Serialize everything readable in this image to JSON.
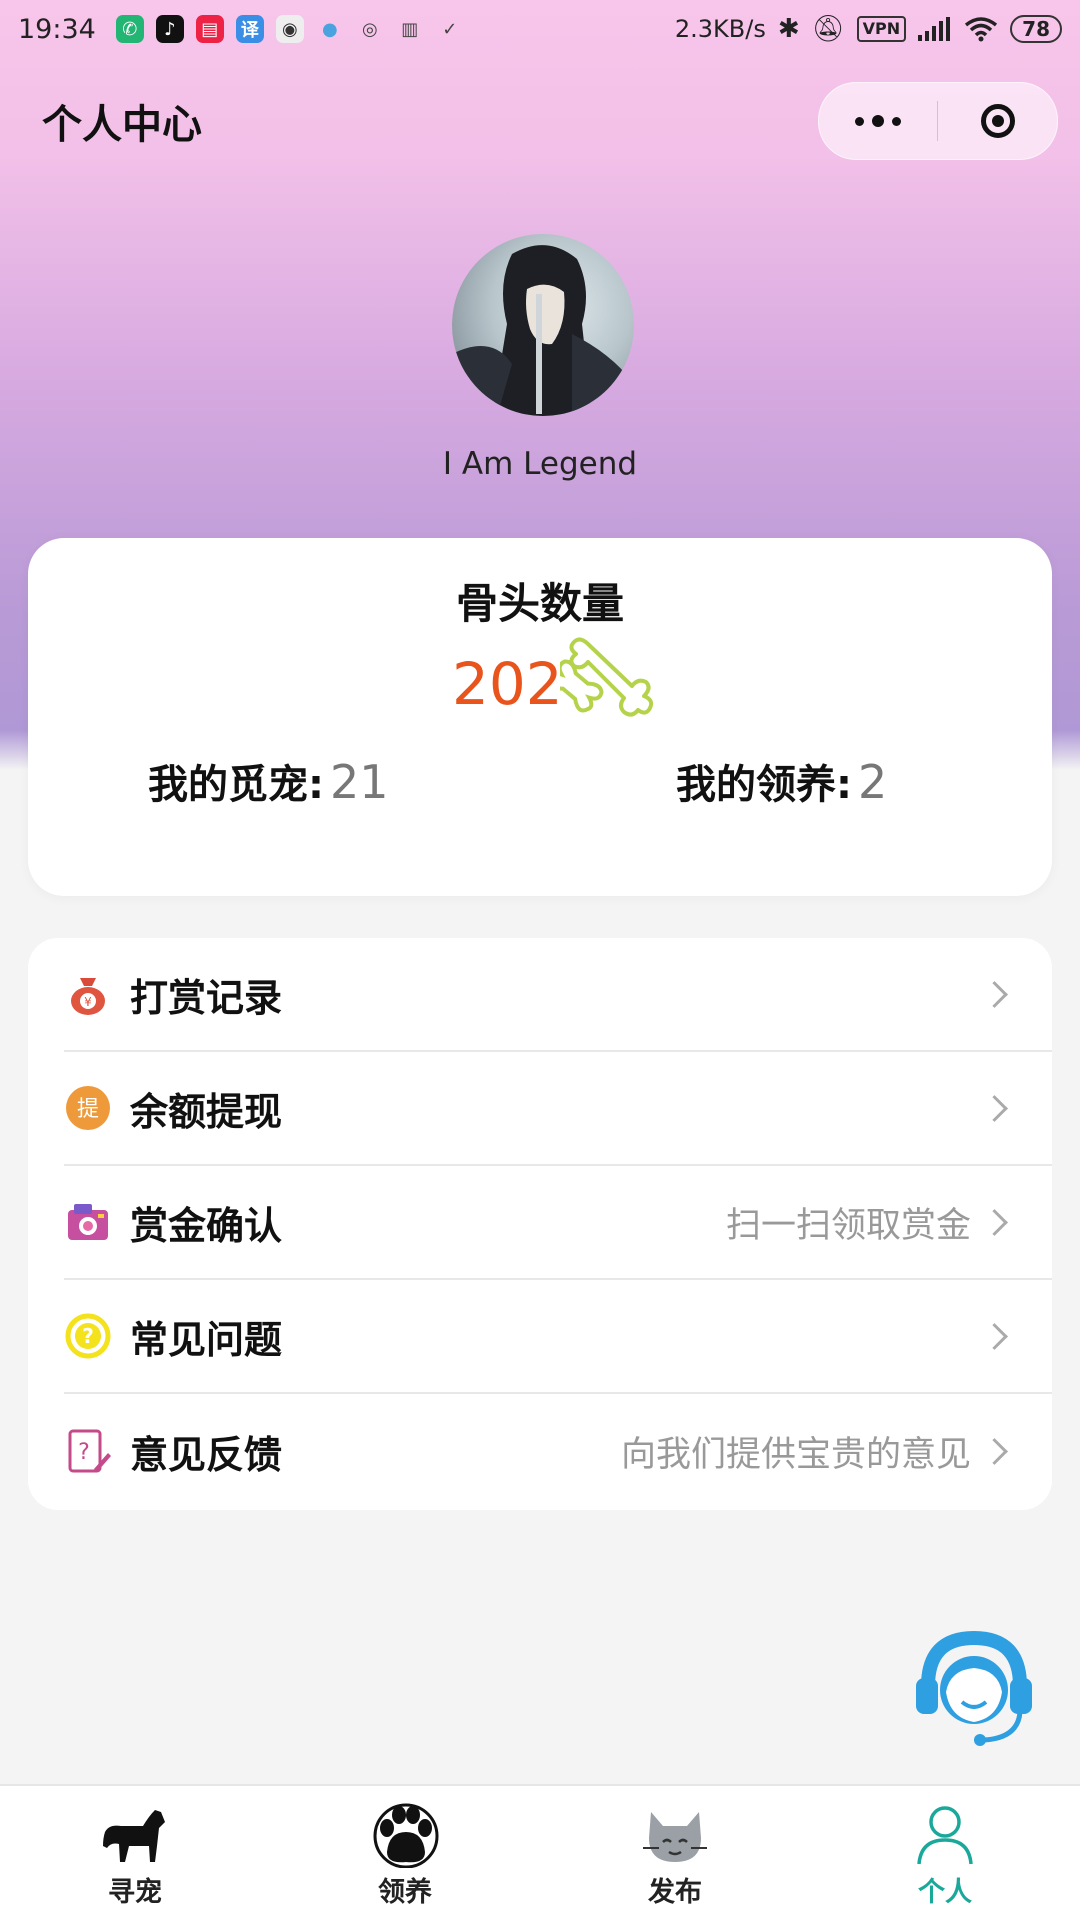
{
  "status_bar": {
    "time": "19:34",
    "net_speed": "2.3KB/s",
    "vpn": "VPN",
    "battery": "78",
    "app_icons": [
      "green-chat-icon",
      "tiktok-icon",
      "docs-icon",
      "translate-icon",
      "eye-icon",
      "balloon-icon",
      "music-icon",
      "trash-icon",
      "check-icon"
    ]
  },
  "nav": {
    "title": "个人中心"
  },
  "profile": {
    "username": "I Am Legend"
  },
  "stats": {
    "bones_title": "骨头数量",
    "bones_count": "202",
    "my_lost_label": "我的觅宠:",
    "my_lost_value": "21",
    "my_adopt_label": "我的领养:",
    "my_adopt_value": "2"
  },
  "menu": [
    {
      "label": "打赏记录",
      "hint": "",
      "icon": "money-bag-icon"
    },
    {
      "label": "余额提现",
      "hint": "",
      "icon": "withdraw-icon",
      "icon_text": "提"
    },
    {
      "label": "赏金确认",
      "hint": "扫一扫领取赏金",
      "icon": "camera-icon"
    },
    {
      "label": "常见问题",
      "hint": "",
      "icon": "question-icon"
    },
    {
      "label": "意见反馈",
      "hint": "向我们提供宝贵的意见",
      "icon": "feedback-icon"
    }
  ],
  "tabs": [
    {
      "label": "寻宠",
      "icon": "dog-icon"
    },
    {
      "label": "领养",
      "icon": "paw-icon"
    },
    {
      "label": "发布",
      "icon": "cat-icon"
    },
    {
      "label": "个人",
      "icon": "user-icon"
    }
  ],
  "colors": {
    "accent": "#1aa89a",
    "bones_count": "#e8541c",
    "gradient_top": "#f8c6ea",
    "gradient_bottom": "#ad98d6",
    "support_blue": "#2e9fe0"
  }
}
